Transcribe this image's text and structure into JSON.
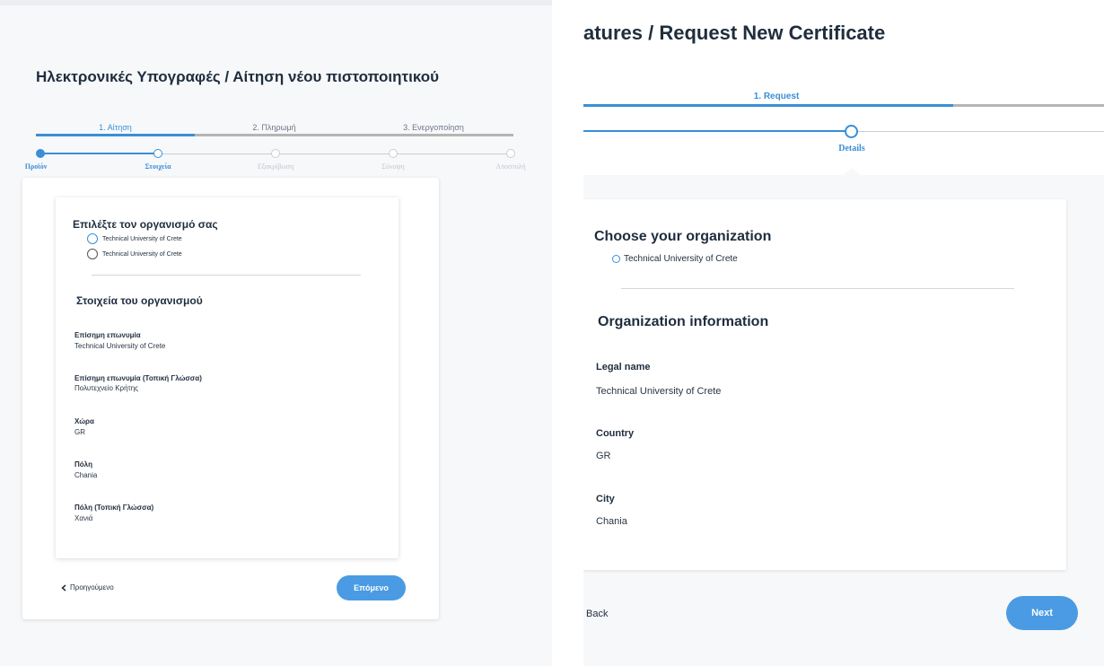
{
  "left": {
    "title": "Ηλεκτρονικές Υπογραφές / Αίτηση νέου πιστοποιητικού",
    "tabs": [
      {
        "label": "1. Αίτηση",
        "active": true
      },
      {
        "label": "2. Πληρωμή",
        "active": false
      },
      {
        "label": "3. Ενεργοποίηση",
        "active": false
      }
    ],
    "substeps": [
      {
        "label": "Προϊόν",
        "state": "done"
      },
      {
        "label": "Στοιχεία",
        "state": "current"
      },
      {
        "label": "Εξακρίβωση",
        "state": "todo"
      },
      {
        "label": "Σύνοψη",
        "state": "todo"
      },
      {
        "label": "Αποστολή",
        "state": "todo"
      }
    ],
    "choose_title": "Επιλέξτε τον οργανισμό σας",
    "org_options": [
      {
        "label": "Technical University of Crete",
        "checked": true
      },
      {
        "label": "Technical University of Crete",
        "checked": false
      }
    ],
    "info_title": "Στοιχεία του οργανισμού",
    "fields": [
      {
        "label": "Επίσημη επωνυμία",
        "value": "Technical University of Crete"
      },
      {
        "label": "Επίσημη επωνυμία (Τοπική Γλώσσα)",
        "value": "Πολυτεχνείο Κρήτης"
      },
      {
        "label": "Χώρα",
        "value": "GR"
      },
      {
        "label": "Πόλη",
        "value": "Chania"
      },
      {
        "label": "Πόλη (Τοπική Γλώσσα)",
        "value": "Χανιά"
      }
    ],
    "back_label": "Προηγούμενο",
    "next_label": "Επόμενο"
  },
  "right": {
    "title": "atures / Request New Certificate",
    "tab_label": "1. Request",
    "substep_label": "Details",
    "choose_title": "Choose your organization",
    "org_option": "Technical University of Crete",
    "info_title": "Organization information",
    "fields": [
      {
        "label": "Legal name",
        "value": "Technical University of Crete"
      },
      {
        "label": "Country",
        "value": "GR"
      },
      {
        "label": "City",
        "value": "Chania"
      }
    ],
    "back_label": "Back",
    "next_label": "Next"
  },
  "colors": {
    "accent": "#3a8fd6",
    "button": "#4a9be3",
    "muted": "#b5b5b5"
  },
  "icons": {
    "back": "chevron-left-icon"
  }
}
